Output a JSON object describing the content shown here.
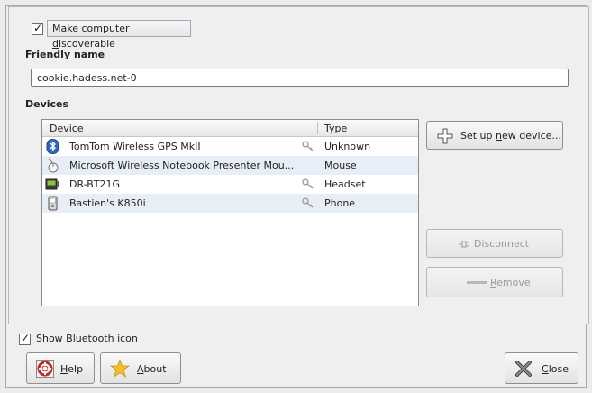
{
  "discoverable": {
    "checked": true,
    "label_pre": "Make computer ",
    "label_mn": "d",
    "label_post": "iscoverable"
  },
  "friendly_name": {
    "title": "Friendly name",
    "value": "cookie.hadess.net-0"
  },
  "devices": {
    "title": "Devices",
    "columns": {
      "device": "Device",
      "type": "Type"
    },
    "rows": [
      {
        "name": "TomTom Wireless GPS MkII",
        "type": "Unknown",
        "icon": "bluetooth-icon",
        "paired_key": true
      },
      {
        "name": "Microsoft Wireless Notebook Presenter Mou...",
        "type": "Mouse",
        "icon": "mouse-icon",
        "paired_key": false
      },
      {
        "name": "DR-BT21G",
        "type": "Headset",
        "icon": "headset-device-icon",
        "paired_key": true
      },
      {
        "name": "Bastien's K850i",
        "type": "Phone",
        "icon": "phone-icon",
        "paired_key": true
      }
    ]
  },
  "actions": {
    "setup_pre": "Set up ",
    "setup_mn": "n",
    "setup_post": "ew device...",
    "disconnect": "Disconnect",
    "remove_pre": "",
    "remove_mn": "R",
    "remove_post": "emove"
  },
  "show_icon": {
    "checked": true,
    "label_mn": "S",
    "label_post": "how Bluetooth icon"
  },
  "footer": {
    "help_mn": "H",
    "help_post": "elp",
    "about_mn": "A",
    "about_post": "bout",
    "close_mn": "C",
    "close_post": "lose"
  },
  "colors": {
    "window_bg": "#efefef",
    "row_alt": "#e8eef7",
    "focus_border": "#9aa9bf"
  }
}
